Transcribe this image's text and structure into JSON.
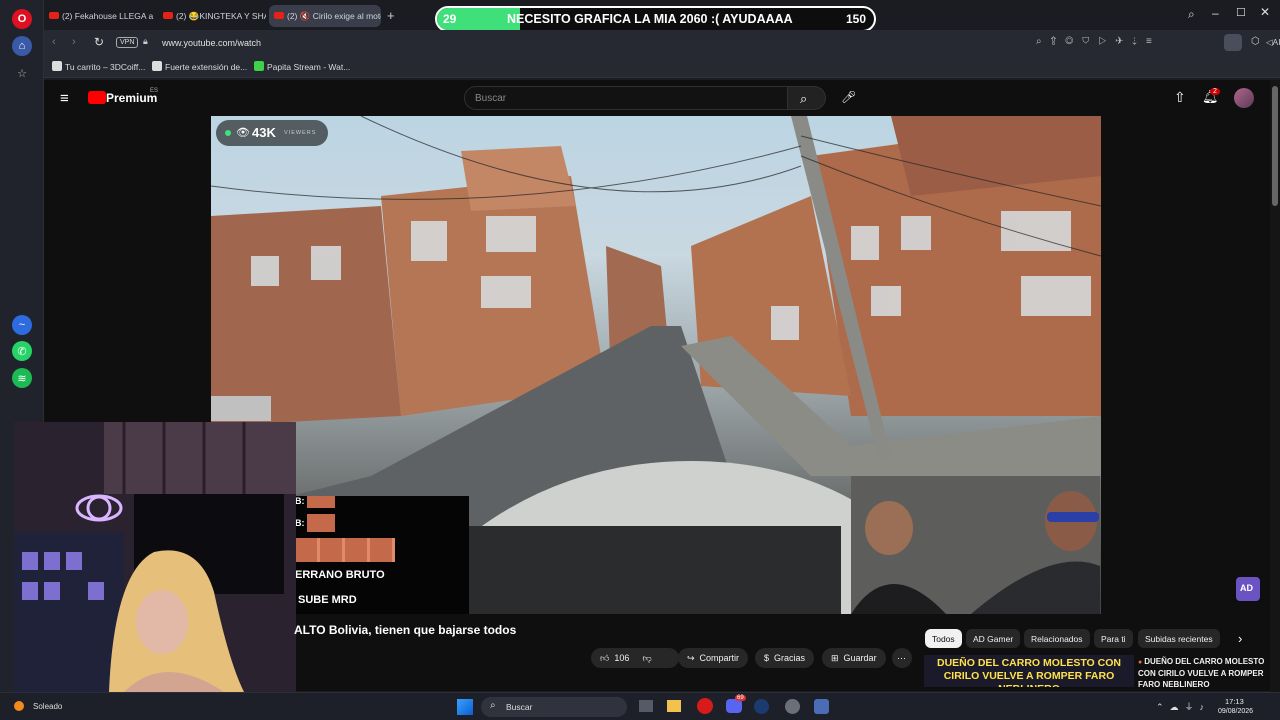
{
  "browser": {
    "tabs": [
      {
        "label": "(2) Fekahouse LLEGA a Bo"
      },
      {
        "label": "(2) 😂KINGTEKA Y SHAKA"
      },
      {
        "label": "(2) 🔇 Cirilo exige al moto"
      }
    ],
    "address": "www.youtube.com/watch",
    "vpn_label": "VPN",
    "ai_label": "AI",
    "bookmarks": [
      {
        "label": "Tu carrito – 3DCoiff..."
      },
      {
        "label": "Fuerte extensión de..."
      },
      {
        "label": "Papita Stream - Wat..."
      }
    ]
  },
  "donation_bar": {
    "current": "29",
    "goal": "150",
    "message": "NECESITO GRAFICA LA MIA 2060 :( AYUDAAAA",
    "progress": 0.19,
    "color": "#3fe07a"
  },
  "youtube": {
    "brand": "Premium",
    "region": "ES",
    "search_placeholder": "Buscar",
    "notification_count": "2"
  },
  "stream": {
    "viewers": "43K",
    "viewers_label": "VIEWERS",
    "watermark": "AD"
  },
  "chat": {
    "lines": [
      {
        "prefix": "B:",
        "text": ""
      },
      {
        "prefix": "B:",
        "text": ""
      },
      {
        "prefix": "",
        "text": "ERRANO BRUTO"
      },
      {
        "prefix": "",
        "text": "SUBE MRD"
      }
    ]
  },
  "video": {
    "title": "ALTO Bolivia, tienen que bajarse todos",
    "like_count": "106",
    "share_label": "Compartir",
    "thanks_label": "Gracias",
    "save_label": "Guardar"
  },
  "related": {
    "chips": [
      "Todos",
      "AD Gamer",
      "Relacionados",
      "Para ti",
      "Subidas recientes"
    ],
    "thumb_text": "DUEÑO DEL CARRO MOLESTO CON CIRILO VUELVE A ROMPER FARO NEBLINERO",
    "item_title": "DUEÑO DEL CARRO MOLESTO CON CIRILO VUELVE A ROMPER FARO NEBLINERO"
  },
  "taskbar": {
    "weather": "Soleado",
    "search": "Buscar",
    "time": "17:13",
    "date": "09/08/2026",
    "discord_badge": "69"
  }
}
